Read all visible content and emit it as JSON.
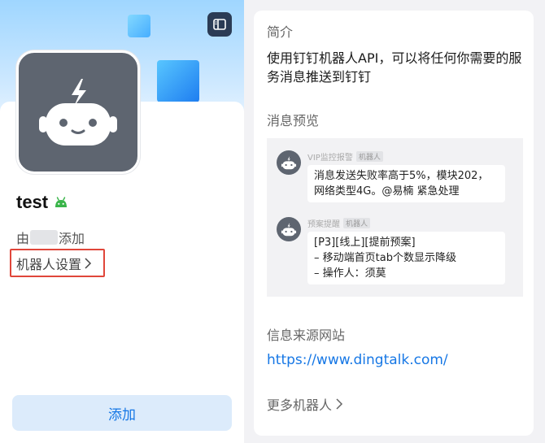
{
  "left": {
    "bot_name": "test",
    "added_by_prefix": "由",
    "added_by_suffix": "添加",
    "settings_label": "机器人设置",
    "add_button_label": "添加"
  },
  "right": {
    "intro_title": "简介",
    "intro_text": "使用钉钉机器人API，可以将任何你需要的服务消息推送到钉钉",
    "preview_title": "消息预览",
    "messages": [
      {
        "sender": "VIP监控报警",
        "tag": "机器人",
        "lines": [
          "消息发送失败率高于5%，模块202，",
          "网络类型4G。@易楠 紧急处理"
        ]
      },
      {
        "sender": "预案提醒",
        "tag": "机器人",
        "lines": [
          "[P3][线上][提前预案]",
          "– 移动端首页tab个数显示降级",
          "– 操作人：须莫"
        ]
      }
    ],
    "source_title": "信息来源网站",
    "source_url": "https://www.dingtalk.com/",
    "more_bots_label": "更多机器人"
  },
  "icons": {
    "sidebar_toggle": "sidebar-toggle-icon",
    "robot_avatar": "robot-icon",
    "android": "android-icon",
    "chevron": "chevron-right-icon"
  },
  "colors": {
    "accent": "#1677e5",
    "highlight_border": "#e0463a",
    "android_green": "#3ab54a"
  }
}
